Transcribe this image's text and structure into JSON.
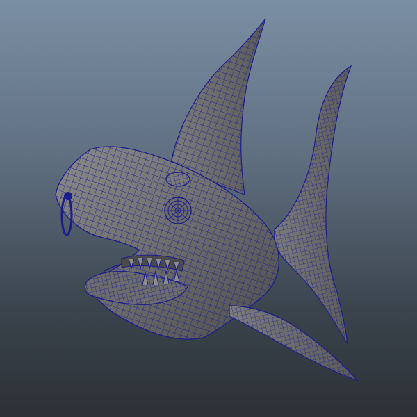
{
  "viewport": {
    "background_top": "#7b8fa4",
    "background_bottom": "#2c3136"
  },
  "model": {
    "shading_color": "#6f6f6f",
    "wire_color": "#1b1c8f",
    "parts": [
      "body",
      "dorsal-fin",
      "tail-fin",
      "pectoral-fin",
      "eye",
      "jaw",
      "teeth",
      "nose-ring"
    ]
  }
}
